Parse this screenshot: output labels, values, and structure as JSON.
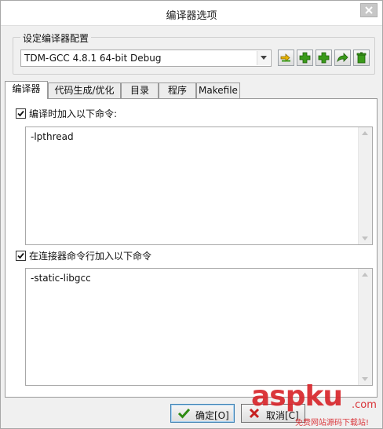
{
  "window": {
    "title": "编译器选项"
  },
  "config_group": {
    "label": "设定编译器配置",
    "selected_profile": "TDM-GCC 4.8.1 64-bit Debug"
  },
  "toolbar_icons": [
    "rename-config-icon",
    "add-config-icon",
    "add-config-alt-icon",
    "export-config-icon",
    "delete-config-icon"
  ],
  "tabs": [
    {
      "label": "编译器"
    },
    {
      "label": "代码生成/优化"
    },
    {
      "label": "目录"
    },
    {
      "label": "程序"
    },
    {
      "label": "Makefile"
    }
  ],
  "compiler_commands": {
    "label": "编译时加入以下命令:",
    "checked": true,
    "value": "-lpthread"
  },
  "linker_commands": {
    "label": "在连接器命令行加入以下命令",
    "checked": true,
    "value": "-static-libgcc"
  },
  "buttons": {
    "ok_label": "确定[O]",
    "cancel_label": "取消[C]"
  },
  "watermark": {
    "brand": "aspku",
    "suffix": ".com",
    "tagline": "免费网站源码下载站!"
  },
  "colors": {
    "accent_green": "#3a9a1a",
    "watermark_red": "#d8262b"
  }
}
